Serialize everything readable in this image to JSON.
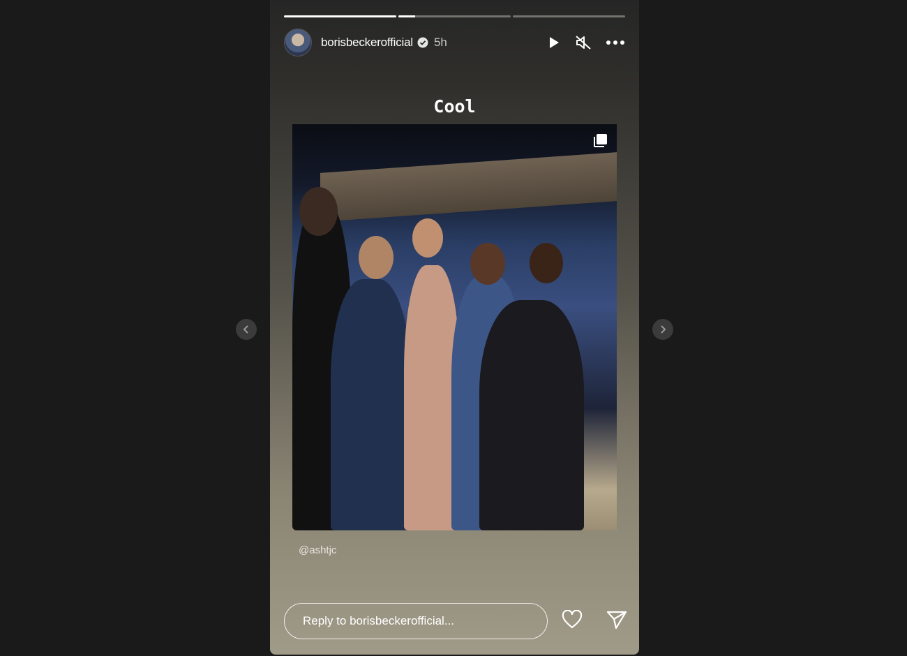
{
  "story": {
    "username": "borisbeckerofficial",
    "time_ago": "5h",
    "caption": "Cool",
    "mention": "@ashtjc",
    "progress": [
      1.0,
      0.15,
      0.0
    ],
    "reply_placeholder": "Reply to borisbeckerofficial..."
  },
  "icons": {
    "verified": "verified-badge-icon",
    "play": "play-icon",
    "mute": "muted-speaker-icon",
    "more": "more-dots-icon",
    "multi": "multiple-photos-icon",
    "like": "heart-icon",
    "share": "send-icon",
    "prev": "chevron-left-icon",
    "next": "chevron-right-icon"
  },
  "colors": {
    "page_bg": "#1a1a1a",
    "text": "#ffffff"
  }
}
